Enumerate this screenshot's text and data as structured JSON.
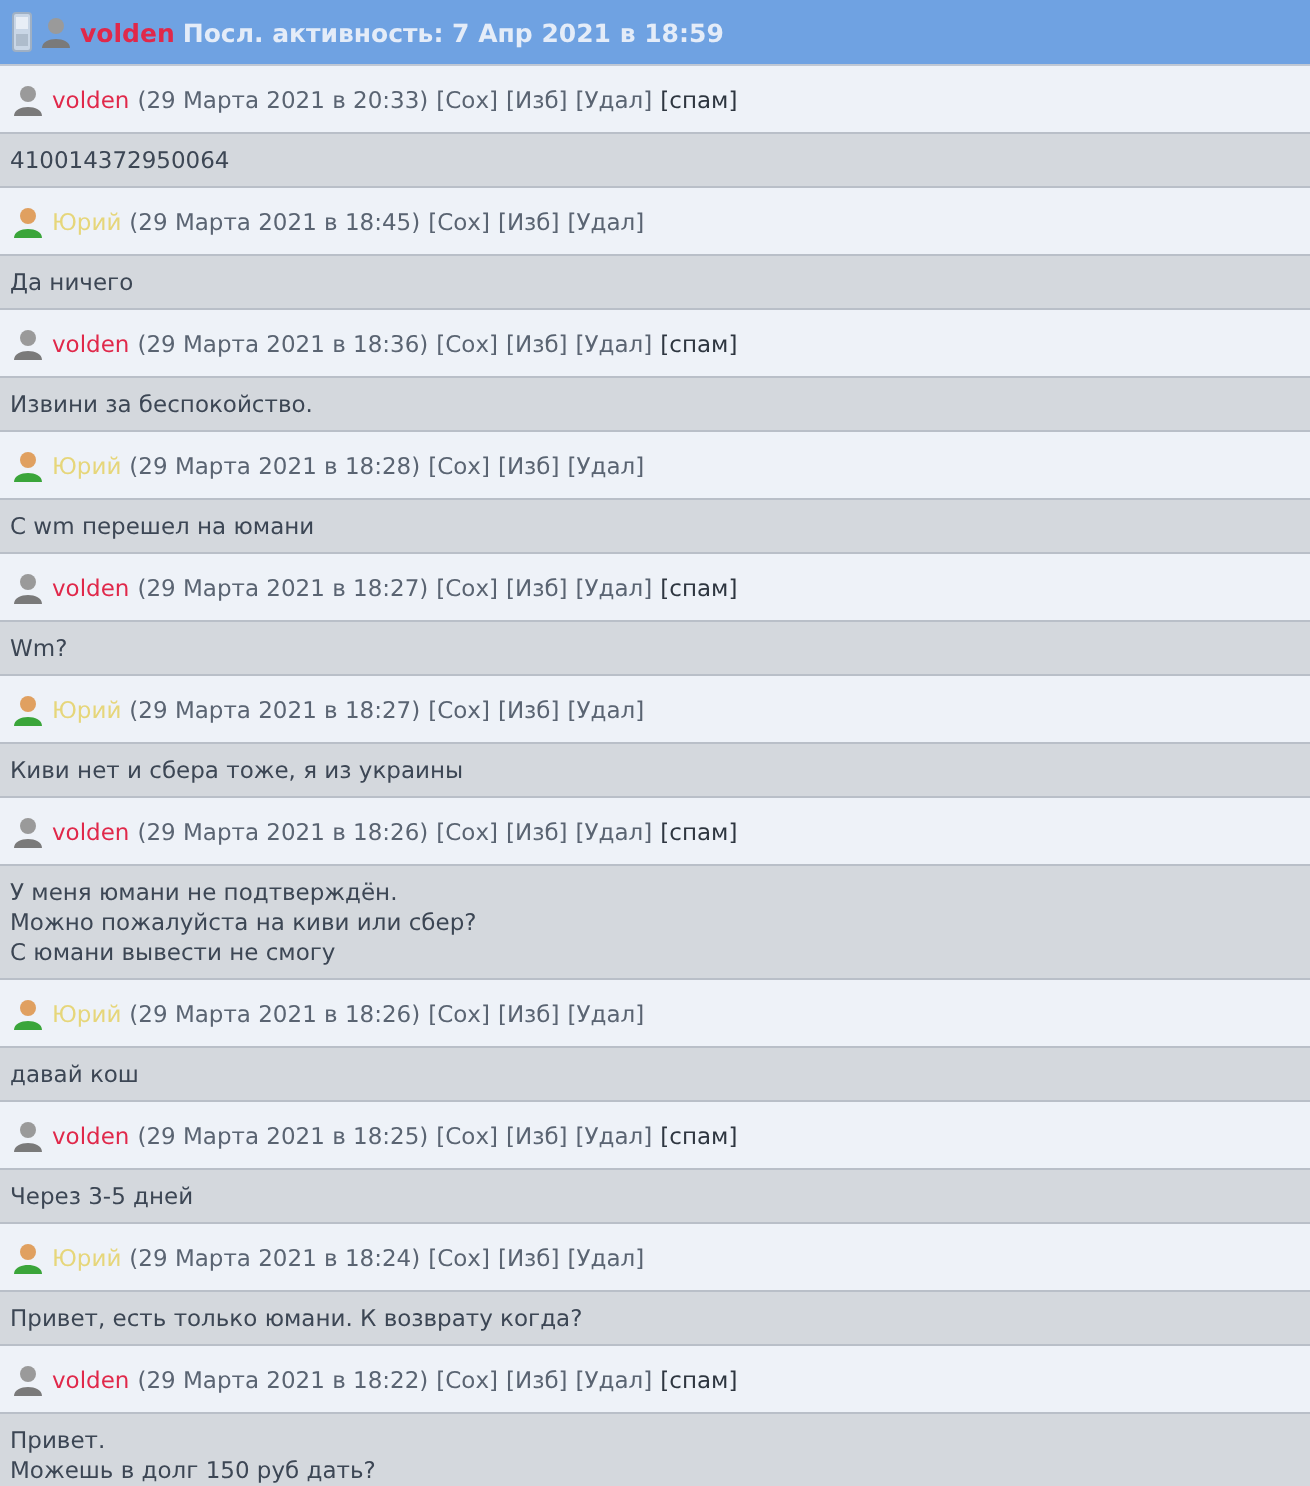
{
  "header": {
    "user": {
      "name": "volden",
      "kind": "moderator"
    },
    "activity": "Посл. активность: 7 Апр 2021 в 18:59"
  },
  "messages": [
    {
      "author": {
        "name": "volden",
        "kind": "moderator"
      },
      "date": "(29 Марта 2021 в 20:33)",
      "actions": [
        {
          "label": "[Сох]",
          "kind": "normal"
        },
        {
          "label": "[Изб]",
          "kind": "normal"
        },
        {
          "label": "[Удал]",
          "kind": "normal"
        },
        {
          "label": "[спам]",
          "kind": "spam"
        }
      ],
      "text": "410014372950064"
    },
    {
      "author": {
        "name": "Юрий",
        "kind": "user"
      },
      "date": "(29 Марта 2021 в 18:45)",
      "actions": [
        {
          "label": "[Сох]",
          "kind": "normal"
        },
        {
          "label": "[Изб]",
          "kind": "normal"
        },
        {
          "label": "[Удал]",
          "kind": "normal"
        }
      ],
      "text": "Да ничего"
    },
    {
      "author": {
        "name": "volden",
        "kind": "moderator"
      },
      "date": "(29 Марта 2021 в 18:36)",
      "actions": [
        {
          "label": "[Сох]",
          "kind": "normal"
        },
        {
          "label": "[Изб]",
          "kind": "normal"
        },
        {
          "label": "[Удал]",
          "kind": "normal"
        },
        {
          "label": "[спам]",
          "kind": "spam"
        }
      ],
      "text": "Извини за беспокойство."
    },
    {
      "author": {
        "name": "Юрий",
        "kind": "user"
      },
      "date": "(29 Марта 2021 в 18:28)",
      "actions": [
        {
          "label": "[Сох]",
          "kind": "normal"
        },
        {
          "label": "[Изб]",
          "kind": "normal"
        },
        {
          "label": "[Удал]",
          "kind": "normal"
        }
      ],
      "text": "С wm перешел на юмани"
    },
    {
      "author": {
        "name": "volden",
        "kind": "moderator"
      },
      "date": "(29 Марта 2021 в 18:27)",
      "actions": [
        {
          "label": "[Сох]",
          "kind": "normal"
        },
        {
          "label": "[Изб]",
          "kind": "normal"
        },
        {
          "label": "[Удал]",
          "kind": "normal"
        },
        {
          "label": "[спам]",
          "kind": "spam"
        }
      ],
      "text": "Wm?"
    },
    {
      "author": {
        "name": "Юрий",
        "kind": "user"
      },
      "date": "(29 Марта 2021 в 18:27)",
      "actions": [
        {
          "label": "[Сох]",
          "kind": "normal"
        },
        {
          "label": "[Изб]",
          "kind": "normal"
        },
        {
          "label": "[Удал]",
          "kind": "normal"
        }
      ],
      "text": "Киви нет и сбера тоже, я из украины"
    },
    {
      "author": {
        "name": "volden",
        "kind": "moderator"
      },
      "date": "(29 Марта 2021 в 18:26)",
      "actions": [
        {
          "label": "[Сох]",
          "kind": "normal"
        },
        {
          "label": "[Изб]",
          "kind": "normal"
        },
        {
          "label": "[Удал]",
          "kind": "normal"
        },
        {
          "label": "[спам]",
          "kind": "spam"
        }
      ],
      "text": "У меня юмани не подтверждён.\nМожно пожалуйста на киви или сбер?\nС юмани вывести не смогу"
    },
    {
      "author": {
        "name": "Юрий",
        "kind": "user"
      },
      "date": "(29 Марта 2021 в 18:26)",
      "actions": [
        {
          "label": "[Сох]",
          "kind": "normal"
        },
        {
          "label": "[Изб]",
          "kind": "normal"
        },
        {
          "label": "[Удал]",
          "kind": "normal"
        }
      ],
      "text": "давай кош"
    },
    {
      "author": {
        "name": "volden",
        "kind": "moderator"
      },
      "date": "(29 Марта 2021 в 18:25)",
      "actions": [
        {
          "label": "[Сох]",
          "kind": "normal"
        },
        {
          "label": "[Изб]",
          "kind": "normal"
        },
        {
          "label": "[Удал]",
          "kind": "normal"
        },
        {
          "label": "[спам]",
          "kind": "spam"
        }
      ],
      "text": "Через 3-5 дней"
    },
    {
      "author": {
        "name": "Юрий",
        "kind": "user"
      },
      "date": "(29 Марта 2021 в 18:24)",
      "actions": [
        {
          "label": "[Сох]",
          "kind": "normal"
        },
        {
          "label": "[Изб]",
          "kind": "normal"
        },
        {
          "label": "[Удал]",
          "kind": "normal"
        }
      ],
      "text": "Привет, есть только юмани. К возврату когда?"
    },
    {
      "author": {
        "name": "volden",
        "kind": "moderator"
      },
      "date": "(29 Марта 2021 в 18:22)",
      "actions": [
        {
          "label": "[Сох]",
          "kind": "normal"
        },
        {
          "label": "[Изб]",
          "kind": "normal"
        },
        {
          "label": "[Удал]",
          "kind": "normal"
        },
        {
          "label": "[спам]",
          "kind": "spam"
        }
      ],
      "text": "Привет.\nМожешь в долг 150 руб дать?"
    }
  ]
}
